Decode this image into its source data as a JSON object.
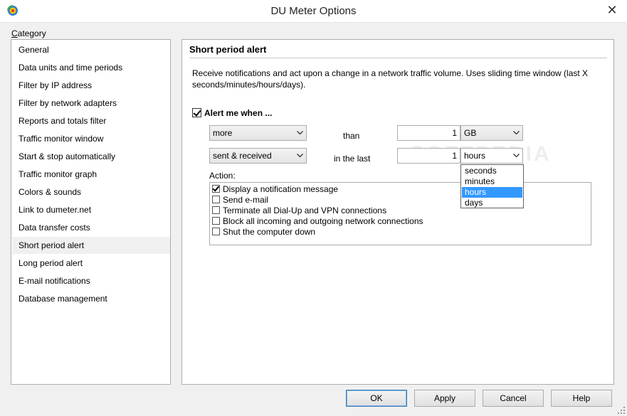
{
  "window": {
    "title": "DU Meter Options",
    "close_glyph": "✕",
    "app_icon": "du-meter-icon"
  },
  "sidebar": {
    "label": "Category",
    "items": [
      {
        "label": "General"
      },
      {
        "label": "Data units and time periods"
      },
      {
        "label": "Filter by IP address"
      },
      {
        "label": "Filter by network adapters"
      },
      {
        "label": "Reports and totals filter"
      },
      {
        "label": "Traffic monitor window"
      },
      {
        "label": "Start & stop automatically"
      },
      {
        "label": "Traffic monitor graph"
      },
      {
        "label": "Colors & sounds"
      },
      {
        "label": "Link to dumeter.net"
      },
      {
        "label": "Data transfer costs"
      },
      {
        "label": "Short period alert"
      },
      {
        "label": "Long period alert"
      },
      {
        "label": "E-mail notifications"
      },
      {
        "label": "Database management"
      }
    ],
    "selected": "Short period alert"
  },
  "panel": {
    "title": "Short period alert",
    "description": "Receive notifications and act upon a change in a network traffic volume. Uses sliding time window (last X seconds/minutes/hours/days).",
    "alert_checkbox_label": "Alert me when ...",
    "alert_checked": true,
    "condition": {
      "comparison_value": "more",
      "than_label": "than",
      "amount_value": "1",
      "unit_value": "GB",
      "direction_value": "sent & received",
      "in_the_last_label": "in the last",
      "period_value": "1",
      "period_unit_value": "hours",
      "period_unit_options": [
        "seconds",
        "minutes",
        "hours",
        "days"
      ],
      "period_unit_selected": "hours"
    },
    "action_label": "Action:",
    "actions": [
      {
        "label": "Display a notification message",
        "checked": true
      },
      {
        "label": "Send e-mail",
        "checked": false
      },
      {
        "label": "Terminate all Dial-Up and VPN connections",
        "checked": false
      },
      {
        "label": "Block all incoming and outgoing network connections",
        "checked": false
      },
      {
        "label": "Shut the computer down",
        "checked": false
      }
    ],
    "watermark": "SOFTPEDIA"
  },
  "buttons": {
    "ok": "OK",
    "apply": "Apply",
    "cancel": "Cancel",
    "help": "Help"
  },
  "colors": {
    "selection_blue": "#3399ff",
    "window_bg": "#f0f0f0"
  }
}
